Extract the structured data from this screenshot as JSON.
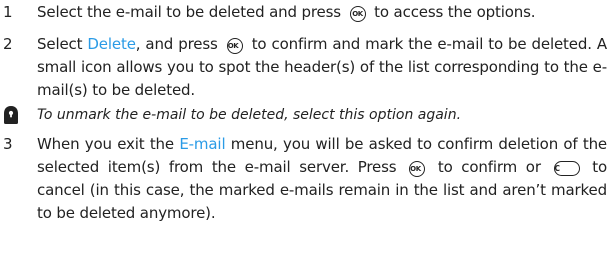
{
  "steps": [
    {
      "number": "1",
      "before": "Select the e-mail to be deleted and press",
      "key": "OK",
      "after": "to access the options."
    },
    {
      "number": "2",
      "before": "Select",
      "highlight": "Delete",
      "middle": ", and press",
      "key": "OK",
      "after": "to confirm and mark the e-mail to be deleted. A small icon allows you to spot the header(s) of the list corresponding to the e-mail(s) to be deleted."
    },
    {
      "number": "3",
      "before": "When you exit the",
      "highlight": "E-mail",
      "middle": "menu, you will be asked to confirm deletion of the selected item(s) from the e-mail server. Press",
      "key": "OK",
      "mid2": "to confirm or",
      "key2": "C",
      "after": "to cancel (in this case, the marked e-mails remain in the list and aren’t marked to be deleted anymore)."
    }
  ],
  "note": {
    "icon": "info-note-icon",
    "text": "To unmark the e-mail to be deleted, select this option again."
  },
  "colors": {
    "highlight": "#2a9be6",
    "text": "#222222"
  }
}
